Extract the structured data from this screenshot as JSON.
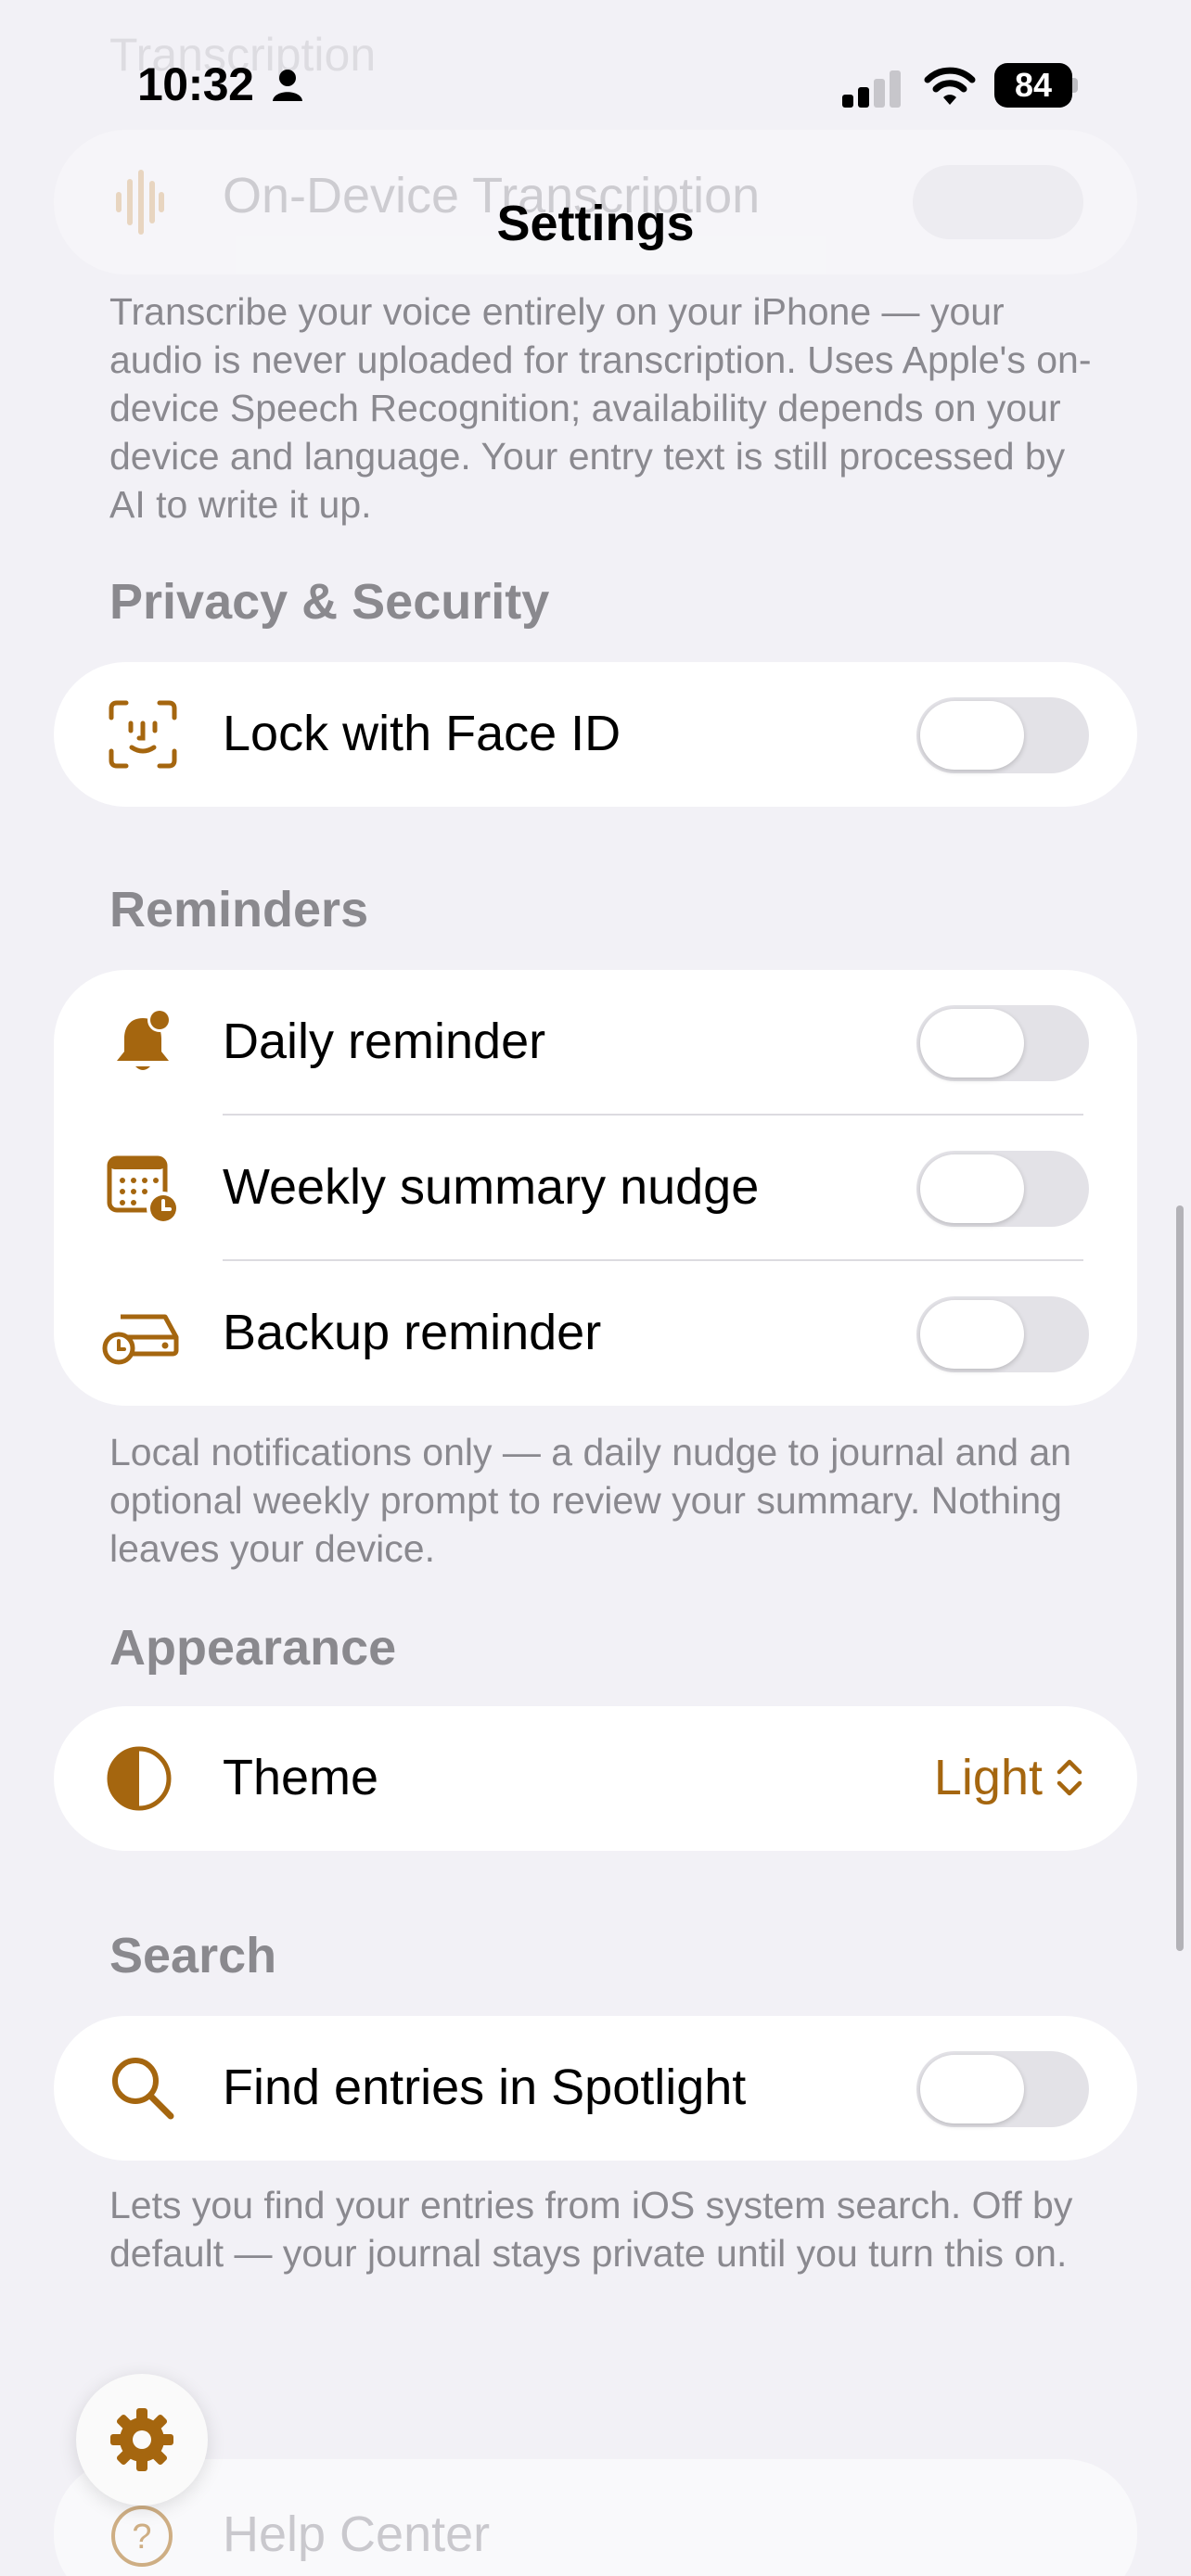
{
  "status_bar": {
    "time": "10:32",
    "battery": "84"
  },
  "nav": {
    "title": "Settings"
  },
  "transcription": {
    "section_title": "Transcription",
    "on_device_label": "On-Device Transcription",
    "on_device_enabled": false,
    "footnote": "Transcribe your voice entirely on your iPhone — your audio is never uploaded for transcription. Uses Apple's on-device Speech Recognition; availability depends on your device and language. Your entry text is still processed by AI to write it up."
  },
  "privacy": {
    "section_title": "Privacy & Security",
    "face_id_label": "Lock with Face ID",
    "face_id_enabled": false
  },
  "reminders": {
    "section_title": "Reminders",
    "items": [
      {
        "label": "Daily reminder",
        "enabled": false,
        "icon": "bell-badge-icon"
      },
      {
        "label": "Weekly summary nudge",
        "enabled": false,
        "icon": "calendar-clock-icon"
      },
      {
        "label": "Backup reminder",
        "enabled": false,
        "icon": "external-drive-clock-icon"
      }
    ],
    "footnote": "Local notifications only — a daily nudge to journal and an optional weekly prompt to review your summary. Nothing leaves your device."
  },
  "appearance": {
    "section_title": "Appearance",
    "theme_label": "Theme",
    "theme_value": "Light"
  },
  "search": {
    "section_title": "Search",
    "spotlight_label": "Find entries in Spotlight",
    "spotlight_enabled": false,
    "footnote": "Lets you find your entries from iOS system search. Off by default — your journal stays private until you turn this on."
  },
  "help": {
    "label": "Help Center"
  },
  "colors": {
    "accent": "#A5660F",
    "background": "#F2F1F6",
    "card": "#FFFFFF",
    "secondary_text": "#8A898F"
  }
}
